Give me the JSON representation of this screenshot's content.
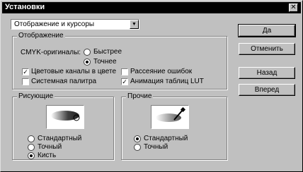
{
  "window": {
    "title": "Установки",
    "close_glyph": "✕"
  },
  "category_select": {
    "value": "Отображение и курсоры"
  },
  "display_group": {
    "label": "Отображение",
    "cmyk_label": "CMYK-оригиналы:",
    "cmyk_options": [
      {
        "label": "Быстрее",
        "selected": false
      },
      {
        "label": "Точнее",
        "selected": true
      }
    ],
    "checkboxes": [
      {
        "label": "Цветовые каналы в цвете",
        "checked": true
      },
      {
        "label": "Системная палитра",
        "checked": false
      },
      {
        "label": "Рассеяние ошибок",
        "checked": false
      },
      {
        "label": "Анимация таблиц LUT",
        "checked": true
      }
    ]
  },
  "painting_group": {
    "label": "Рисующие",
    "options": [
      {
        "label": "Стандартный",
        "selected": false
      },
      {
        "label": "Точный",
        "selected": false
      },
      {
        "label": "Кисть",
        "selected": true
      }
    ]
  },
  "other_group": {
    "label": "Прочие",
    "options": [
      {
        "label": "Стандартный",
        "selected": true
      },
      {
        "label": "Точный",
        "selected": false
      }
    ]
  },
  "buttons": {
    "ok": "Да",
    "cancel": "Отменить",
    "back": "Назад",
    "forward": "Вперед"
  }
}
